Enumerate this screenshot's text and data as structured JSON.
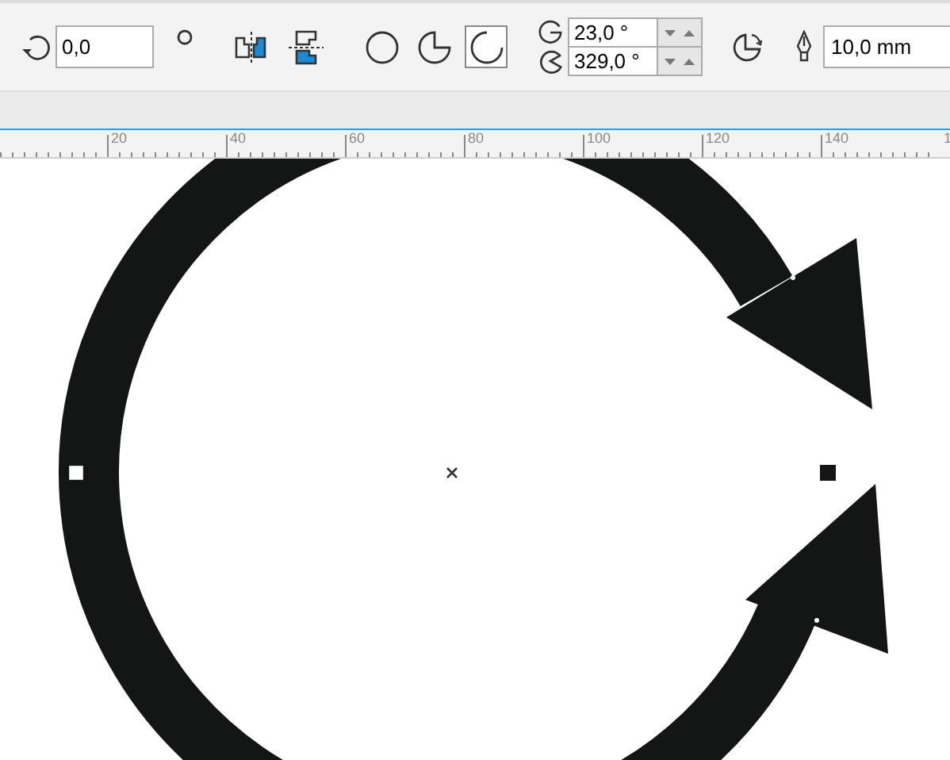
{
  "toolbar": {
    "rotation": {
      "value": "0,0"
    },
    "shape_types": [
      {
        "kind": "ellipse",
        "selected": false
      },
      {
        "kind": "pie",
        "selected": false
      },
      {
        "kind": "arc",
        "selected": true
      }
    ],
    "angles": [
      {
        "kind": "start",
        "value": "23,0 °"
      },
      {
        "kind": "end",
        "value": "329,0 °"
      }
    ],
    "outline": {
      "value": "10,0 mm"
    }
  },
  "ruler": {
    "labels": [
      "20",
      "40",
      "60",
      "80",
      "100",
      "120",
      "140",
      "1"
    ]
  }
}
